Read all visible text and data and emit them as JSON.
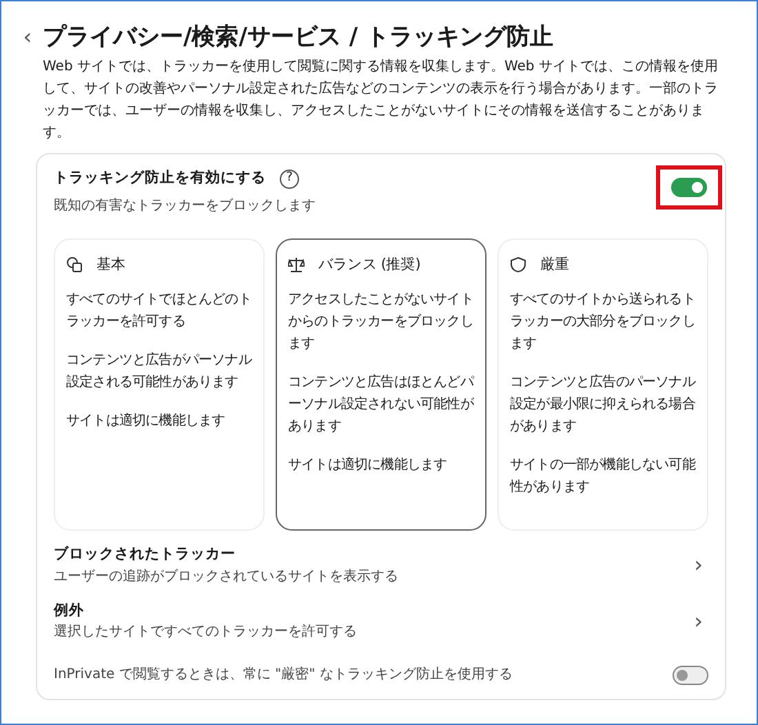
{
  "page": {
    "back": "‹",
    "title": "プライバシー/検索/サービス / トラッキング防止",
    "description": "Web サイトでは、トラッカーを使用して閲覧に関する情報を収集します。Web サイトでは、この情報を使用して、サイトの改善やパーソナル設定された広告などのコンテンツの表示を行う場合があります。一部のトラッカーでは、ユーザーの情報を収集し、アクセスしたことがないサイトにその情報を送信することがあります。"
  },
  "main_toggle": {
    "label": "トラッキング防止を有効にする",
    "help": "?",
    "description": "既知の有害なトラッカーをブロックします",
    "on": true,
    "highlighted": true
  },
  "levels": [
    {
      "kind": "basic",
      "title": "基本",
      "selected": false,
      "points": [
        "すべてのサイトでほとんどのトラッカーを許可する",
        "コンテンツと広告がパーソナル設定される可能性があります",
        "サイトは適切に機能します"
      ]
    },
    {
      "kind": "balanced",
      "title": "バランス (推奨)",
      "selected": true,
      "points": [
        "アクセスしたことがないサイトからのトラッカーをブロックします",
        "コンテンツと広告はほとんどパーソナル設定されない可能性があります",
        "サイトは適切に機能します"
      ]
    },
    {
      "kind": "strict",
      "title": "厳重",
      "selected": false,
      "points": [
        "すべてのサイトから送られるトラッカーの大部分をブロックします",
        "コンテンツと広告のパーソナル設定が最小限に抑えられる場合があります",
        "サイトの一部が機能しない可能性があります"
      ]
    }
  ],
  "links": [
    {
      "title": "ブロックされたトラッカー",
      "description": "ユーザーの追跡がブロックされているサイトを表示する",
      "arrow": "›"
    },
    {
      "title": "例外",
      "description": "選択したサイトですべてのトラッカーを許可する",
      "arrow": "›"
    }
  ],
  "inprivate_toggle": {
    "label": "InPrivate で閲覧するときは、常に \"厳密\" なトラッキング防止を使用する",
    "on": false
  }
}
